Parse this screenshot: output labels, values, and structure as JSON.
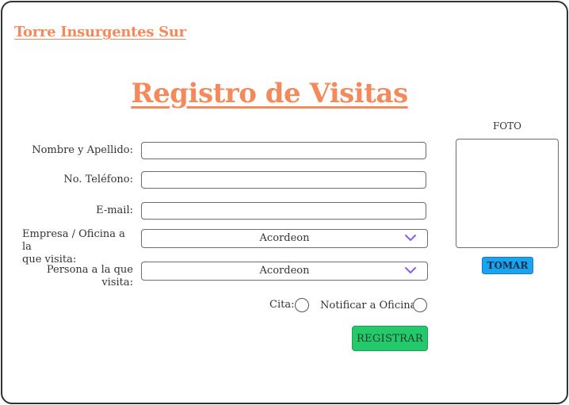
{
  "header": {
    "brand": "Torre Insurgentes Sur",
    "title": "Registro de Visitas"
  },
  "form": {
    "name_label": "Nombre y Apellido:",
    "name_value": "",
    "phone_label": "No. Teléfono:",
    "phone_value": "",
    "email_label": "E-mail:",
    "email_value": "",
    "company_label_line1": "Empresa / Oficina a la",
    "company_label_line2": "que visita:",
    "company_selected": "Acordeon",
    "person_label": "Persona a la que visita:",
    "person_selected": "Acordeon",
    "appointment_label": "Cita:",
    "notify_label": "Notificar a Oficina:",
    "register_button": "REGISTRAR"
  },
  "photo": {
    "label": "FOTO",
    "take_button": "TOMAR"
  },
  "colors": {
    "brand": "#f4895b",
    "register_button": "#23c96a",
    "take_button": "#1aa3f0",
    "chevron": "#8b5cf6",
    "frame_border": "#2f3330"
  },
  "icons": {
    "select_arrow": "chevron-down-icon"
  }
}
